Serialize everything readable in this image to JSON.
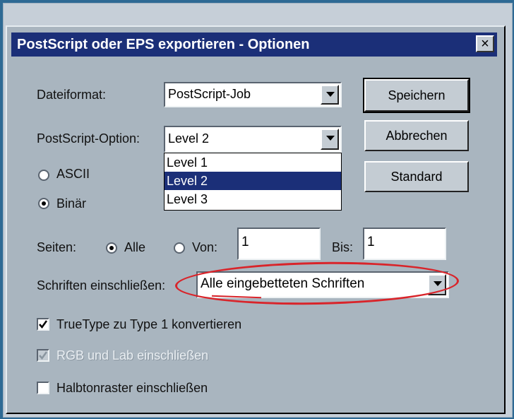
{
  "window": {
    "title": "PostScript oder EPS exportieren - Optionen",
    "close_symbol": "×"
  },
  "dateiformat": {
    "label": "Dateiformat:",
    "value": "PostScript-Job"
  },
  "ps_option": {
    "label": "PostScript-Option:",
    "value": "Level 2",
    "options": [
      "Level 1",
      "Level 2",
      "Level 3"
    ],
    "selected_index": 1
  },
  "encoding": {
    "ascii_label": "ASCII",
    "binary_label": "Binär",
    "selected": "binary"
  },
  "buttons": {
    "save": "Speichern",
    "cancel": "Abbrechen",
    "default": "Standard"
  },
  "pages": {
    "label": "Seiten:",
    "all_label": "Alle",
    "from_label": "Von:",
    "from_value": "1",
    "to_label": "Bis:",
    "to_value": "1",
    "selected": "all"
  },
  "fonts": {
    "label": "Schriften einschließen:",
    "value": "Alle eingebetteten Schriften"
  },
  "checkboxes": [
    {
      "label": "TrueType zu Type 1 konvertieren",
      "checked": true,
      "disabled": false
    },
    {
      "label": "RGB und Lab einschließen",
      "checked": true,
      "disabled": true
    },
    {
      "label": "Halbtonraster einschließen",
      "checked": false,
      "disabled": false
    }
  ],
  "colors": {
    "titlebar": "#1b2f78",
    "dialog_bg": "#a9b5bf",
    "annotation": "#d9242a",
    "background": "#2e6a94"
  },
  "icons": {
    "close": "close-icon",
    "dropdown": "chevron-down-icon",
    "check": "checkmark-icon"
  }
}
